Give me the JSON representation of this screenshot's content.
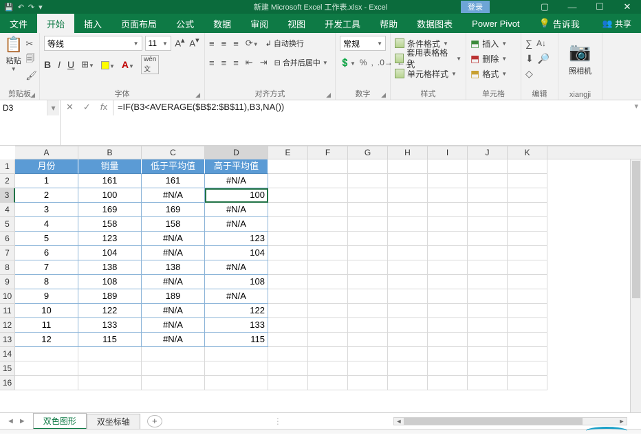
{
  "title": "新建 Microsoft Excel 工作表.xlsx - Excel",
  "login": "登录",
  "tabs": {
    "file": "文件",
    "home": "开始",
    "insert": "插入",
    "layout": "页面布局",
    "formulas": "公式",
    "data": "数据",
    "review": "审阅",
    "view": "视图",
    "dev": "开发工具",
    "help": "帮助",
    "chart": "数据图表",
    "pivot": "Power Pivot",
    "tellme": "告诉我",
    "share": "共享"
  },
  "ribbon": {
    "clipboard": {
      "paste": "粘贴",
      "group": "剪贴板"
    },
    "font": {
      "name": "等线",
      "size": "11",
      "group": "字体"
    },
    "align": {
      "wrap": "自动换行",
      "merge": "合并后居中",
      "group": "对齐方式"
    },
    "number": {
      "format": "常规",
      "group": "数字"
    },
    "styles": {
      "cond": "条件格式",
      "table": "套用表格格式",
      "cell": "单元格样式",
      "group": "样式"
    },
    "cells": {
      "insert": "插入",
      "delete": "删除",
      "format": "格式",
      "group": "单元格"
    },
    "editing": {
      "group": "编辑"
    },
    "camera": {
      "label": "照相机",
      "group": "xiangji"
    }
  },
  "nameBox": "D3",
  "formula": "=IF(B3<AVERAGE($B$2:$B$11),B3,NA())",
  "columns": [
    "A",
    "B",
    "C",
    "D",
    "E",
    "F",
    "G",
    "H",
    "I",
    "J",
    "K"
  ],
  "headerRow": [
    "月份",
    "销量",
    "低于平均值",
    "高于平均值"
  ],
  "rows": [
    {
      "r": "1"
    },
    {
      "r": "2",
      "a": "1",
      "b": "161",
      "c": "161",
      "d": "#N/A"
    },
    {
      "r": "3",
      "a": "2",
      "b": "100",
      "c": "#N/A",
      "d": "100"
    },
    {
      "r": "4",
      "a": "3",
      "b": "169",
      "c": "169",
      "d": "#N/A"
    },
    {
      "r": "5",
      "a": "4",
      "b": "158",
      "c": "158",
      "d": "#N/A"
    },
    {
      "r": "6",
      "a": "5",
      "b": "123",
      "c": "#N/A",
      "d": "123"
    },
    {
      "r": "7",
      "a": "6",
      "b": "104",
      "c": "#N/A",
      "d": "104"
    },
    {
      "r": "8",
      "a": "7",
      "b": "138",
      "c": "138",
      "d": "#N/A"
    },
    {
      "r": "9",
      "a": "8",
      "b": "108",
      "c": "#N/A",
      "d": "108"
    },
    {
      "r": "10",
      "a": "9",
      "b": "189",
      "c": "189",
      "d": "#N/A"
    },
    {
      "r": "11",
      "a": "10",
      "b": "122",
      "c": "#N/A",
      "d": "122"
    },
    {
      "r": "12",
      "a": "11",
      "b": "133",
      "c": "#N/A",
      "d": "133"
    },
    {
      "r": "13",
      "a": "12",
      "b": "115",
      "c": "#N/A",
      "d": "115"
    },
    {
      "r": "14"
    },
    {
      "r": "15"
    },
    {
      "r": "16"
    }
  ],
  "sheets": {
    "s1": "双色图形",
    "s2": "双坐标轴"
  },
  "colWidths": {
    "abcd": 92,
    "rest": 58
  }
}
